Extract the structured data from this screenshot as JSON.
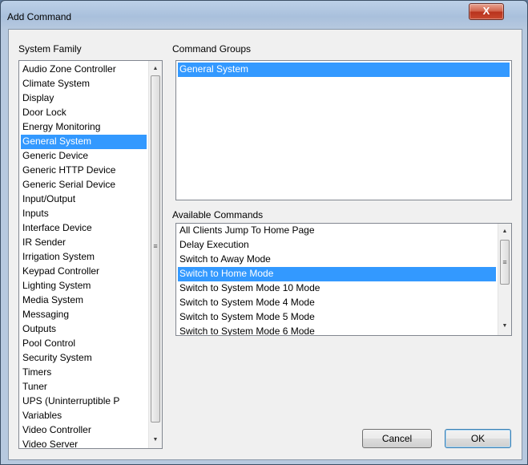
{
  "window": {
    "title": "Add Command",
    "close_label": "X"
  },
  "system_family": {
    "label": "System Family",
    "items": [
      "Audio Zone Controller",
      "Climate System",
      "Display",
      "Door Lock",
      "Energy Monitoring",
      "General System",
      "Generic Device",
      "Generic HTTP Device",
      "Generic Serial Device",
      "Input/Output",
      "Inputs",
      "Interface Device",
      "IR Sender",
      "Irrigation System",
      "Keypad Controller",
      "Lighting System",
      "Media System",
      "Messaging",
      "Outputs",
      "Pool Control",
      "Security System",
      "Timers",
      "Tuner",
      "UPS (Uninterruptible P",
      "Variables",
      "Video Controller",
      "Video Server"
    ],
    "selected": "General System"
  },
  "command_groups": {
    "label": "Command Groups",
    "items": [
      "General System"
    ],
    "selected": "General System"
  },
  "available_commands": {
    "label": "Available Commands",
    "items": [
      "All Clients Jump To Home Page",
      "Delay Execution",
      "Switch to Away Mode",
      "Switch to Home Mode",
      "Switch to System Mode 10 Mode",
      "Switch to System Mode 4 Mode",
      "Switch to System Mode 5 Mode",
      "Switch to System Mode 6 Mode"
    ],
    "selected": "Switch to Home Mode"
  },
  "buttons": {
    "cancel": "Cancel",
    "ok": "OK"
  },
  "icons": {
    "scroll_up": "up-arrow-icon",
    "scroll_down": "down-arrow-icon",
    "grip": "scroll-grip-icon",
    "close": "close-icon"
  }
}
